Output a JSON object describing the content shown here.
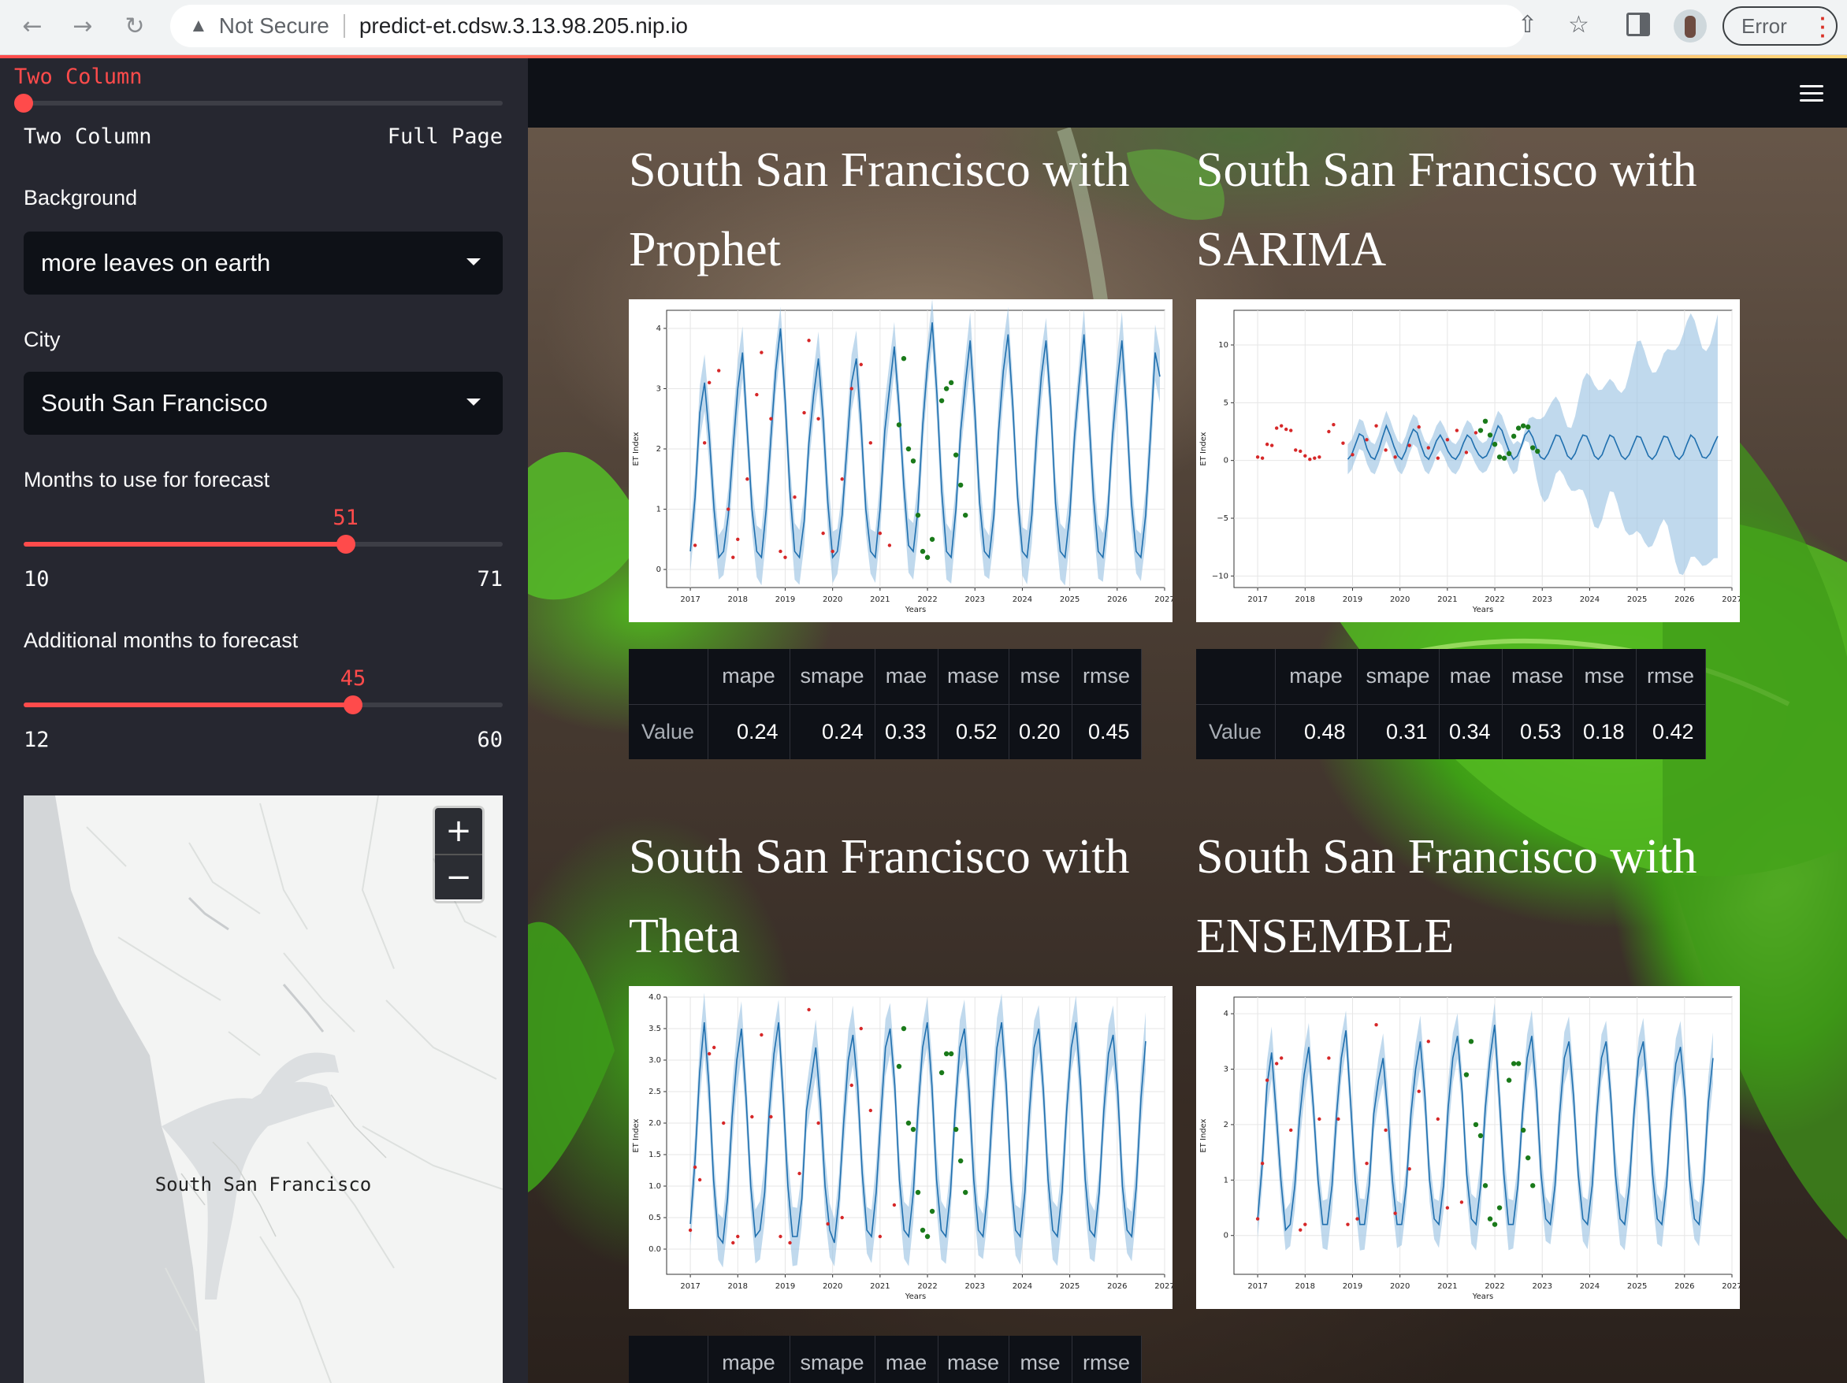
{
  "browser": {
    "security_label": "Not Secure",
    "url": "predict-et.cdsw.3.13.98.205.nip.io",
    "error_label": "Error"
  },
  "sidebar": {
    "layout_selected": "Two Column",
    "layout_slider": {
      "min_label": "Two Column",
      "max_label": "Full Page",
      "position": 0
    },
    "background": {
      "label": "Background",
      "value": "more leaves on earth"
    },
    "city": {
      "label": "City",
      "value": "South San Francisco"
    },
    "months_forecast": {
      "label": "Months to use for forecast",
      "value": "51",
      "min": "10",
      "max": "71"
    },
    "additional_months": {
      "label": "Additional months to forecast",
      "value": "45",
      "min": "12",
      "max": "60"
    },
    "map": {
      "city_label": "South San Francisco",
      "zoom_in": "+",
      "zoom_out": "−"
    }
  },
  "metric_headers": [
    "mape",
    "smape",
    "mae",
    "mase",
    "mse",
    "rmse"
  ],
  "metric_row_label": "Value",
  "panels": [
    {
      "title_line1": "South San Francisco with",
      "title_line2": "Prophet",
      "metrics": [
        "0.24",
        "0.24",
        "0.33",
        "0.52",
        "0.20",
        "0.45"
      ]
    },
    {
      "title_line1": "South San Francisco with",
      "title_line2": "SARIMA",
      "metrics": [
        "0.48",
        "0.31",
        "0.34",
        "0.53",
        "0.18",
        "0.42"
      ]
    },
    {
      "title_line1": "South San Francisco with",
      "title_line2": "Theta"
    },
    {
      "title_line1": "South San Francisco with",
      "title_line2": "ENSEMBLE"
    }
  ],
  "chart_data": [
    {
      "type": "line",
      "xlabel": "Years",
      "ylabel": "ET Index",
      "x_ticks": [
        "2017",
        "2018",
        "2019",
        "2020",
        "2021",
        "2022",
        "2023",
        "2024",
        "2025",
        "2026",
        "2027"
      ],
      "y_ticks": [
        "0",
        "1",
        "2",
        "3",
        "4"
      ],
      "ylim": [
        -0.3,
        4.3
      ],
      "series": [
        {
          "name": "",
          "type": "line",
          "x_range": [
            2017.0,
            2026.9
          ],
          "values": [
            0.3,
            1.2,
            2.6,
            3.1,
            2.2,
            1.0,
            0.2,
            0.3,
            0.9,
            2.0,
            3.0,
            3.6,
            2.3,
            1.0,
            0.3,
            0.2,
            1.0,
            2.2,
            3.3,
            4.0,
            2.8,
            1.3,
            0.3,
            0.2,
            0.8,
            2.1,
            2.9,
            3.5,
            2.5,
            1.1,
            0.2,
            0.3,
            0.9,
            2.0,
            3.1,
            3.5,
            2.4,
            1.0,
            0.3,
            0.2,
            1.0,
            2.3,
            3.0,
            3.7,
            2.7,
            1.4,
            0.4,
            0.3,
            1.0,
            2.4,
            3.4,
            4.1,
            2.9,
            1.3,
            0.3,
            0.2,
            1.0,
            2.3,
            3.1,
            3.8,
            2.6,
            1.1,
            0.3,
            0.2,
            0.9,
            2.3,
            3.3,
            3.9,
            2.7,
            1.2,
            0.3,
            0.2,
            0.9,
            2.2,
            3.2,
            3.8,
            2.7,
            1.1,
            0.3,
            0.2,
            0.9,
            2.2,
            3.1,
            3.9,
            2.6,
            1.2,
            0.3,
            0.2,
            0.9,
            2.2,
            3.1,
            3.8,
            2.6,
            1.1,
            0.3,
            0.2,
            0.9,
            2.2,
            3.6,
            3.2
          ]
        },
        {
          "name": "",
          "type": "points",
          "color": "#d62728",
          "x": [
            2017.1,
            2017.3,
            2017.4,
            2017.6,
            2017.8,
            2017.9,
            2018.0,
            2018.2,
            2018.4,
            2018.5,
            2018.7,
            2018.9,
            2019.0,
            2019.2,
            2019.4,
            2019.5,
            2019.7,
            2019.8,
            2020.0,
            2020.2,
            2020.4,
            2020.6,
            2020.8,
            2021.0,
            2021.2
          ],
          "y": [
            0.4,
            2.1,
            3.1,
            3.3,
            1.0,
            0.2,
            0.5,
            1.5,
            2.9,
            3.6,
            2.5,
            0.3,
            0.2,
            1.2,
            2.6,
            3.8,
            2.5,
            0.6,
            0.3,
            1.5,
            3.0,
            3.4,
            2.1,
            0.6,
            0.4
          ]
        },
        {
          "name": "",
          "type": "points",
          "color": "#1a7a1a",
          "x": [
            2021.4,
            2021.5,
            2021.6,
            2021.7,
            2021.8,
            2021.9,
            2022.0,
            2022.1,
            2022.3,
            2022.4,
            2022.5,
            2022.6,
            2022.7,
            2022.8
          ],
          "y": [
            2.4,
            3.5,
            2.0,
            1.8,
            0.9,
            0.3,
            0.2,
            0.5,
            2.8,
            3.0,
            3.1,
            1.9,
            1.4,
            0.9
          ]
        }
      ]
    },
    {
      "type": "line",
      "xlabel": "Years",
      "ylabel": "ET Index",
      "x_ticks": [
        "2017",
        "2018",
        "2019",
        "2020",
        "2021",
        "2022",
        "2023",
        "2024",
        "2025",
        "2026",
        "2027"
      ],
      "y_ticks": [
        "−10",
        "−5",
        "0",
        "5",
        "10"
      ],
      "ylim": [
        -11,
        13
      ],
      "series": [
        {
          "name": "",
          "type": "line",
          "x_range": [
            2018.9,
            2026.7
          ],
          "values": [
            0.1,
            0.5,
            1.4,
            2.3,
            2.1,
            1.0,
            0.3,
            0.1,
            0.9,
            2.0,
            3.0,
            2.2,
            1.2,
            0.4,
            0.1,
            0.8,
            1.9,
            2.7,
            2.4,
            1.3,
            0.4,
            0.1,
            0.8,
            1.7,
            2.2,
            1.6,
            0.8,
            0.3,
            0.1,
            0.6,
            1.5,
            2.2,
            1.9,
            1.1,
            0.5,
            0.2,
            0.4,
            1.1,
            2.1,
            3.0,
            2.6,
            1.6,
            0.7,
            0.1,
            0.4,
            1.2,
            2.2,
            2.6,
            2.0,
            1.0,
            0.3,
            0.1,
            0.6,
            1.4,
            2.2,
            2.1,
            1.3,
            0.4,
            0.1,
            0.6,
            1.5,
            2.2,
            2.1,
            1.3,
            0.4,
            0.1,
            0.5,
            1.4,
            2.2,
            2.0,
            1.2,
            0.4,
            0.1,
            0.5,
            1.3,
            2.1,
            2.0,
            1.2,
            0.4,
            0.1,
            0.5,
            1.3,
            2.1,
            2.0,
            1.2,
            0.4,
            0.1,
            0.5,
            1.4,
            2.2,
            1.9,
            1.1,
            0.3,
            0.2,
            0.6,
            1.4,
            2.1
          ]
        },
        {
          "name": "",
          "type": "points",
          "color": "#d62728",
          "x": [
            2017.0,
            2017.1,
            2017.2,
            2017.3,
            2017.4,
            2017.5,
            2017.6,
            2017.7,
            2017.8,
            2017.9,
            2018.0,
            2018.1,
            2018.2,
            2018.3,
            2018.5,
            2018.6,
            2018.8,
            2019.0,
            2019.3,
            2019.5,
            2019.7,
            2019.9,
            2020.2,
            2020.4,
            2020.6,
            2020.8,
            2021.0,
            2021.2,
            2021.4,
            2021.6
          ],
          "y": [
            0.3,
            0.2,
            1.4,
            1.3,
            2.8,
            3.0,
            2.7,
            2.6,
            0.9,
            0.8,
            0.4,
            0.1,
            0.2,
            0.3,
            2.5,
            3.1,
            1.5,
            0.5,
            1.8,
            3.0,
            0.9,
            0.3,
            1.3,
            2.9,
            1.1,
            0.2,
            1.8,
            2.6,
            0.7,
            2.4
          ]
        },
        {
          "name": "",
          "type": "points",
          "color": "#1a7a1a",
          "x": [
            2021.7,
            2021.8,
            2021.9,
            2022.0,
            2022.1,
            2022.2,
            2022.3,
            2022.4,
            2022.5,
            2022.6,
            2022.7,
            2022.8,
            2022.9
          ],
          "y": [
            2.6,
            3.4,
            2.2,
            1.4,
            0.3,
            0.2,
            0.6,
            2.1,
            2.8,
            3.0,
            2.9,
            1.1,
            0.8
          ]
        }
      ]
    },
    {
      "type": "line",
      "xlabel": "Years",
      "ylabel": "ET Index",
      "x_ticks": [
        "2017",
        "2018",
        "2019",
        "2020",
        "2021",
        "2022",
        "2023",
        "2024",
        "2025",
        "2026",
        "2027"
      ],
      "y_ticks": [
        "0.0",
        "0.5",
        "1.0",
        "1.5",
        "2.0",
        "2.5",
        "3.0",
        "3.5",
        "4.0"
      ],
      "ylim": [
        -0.4,
        4.0
      ],
      "series": [
        {
          "name": "",
          "type": "line",
          "x_range": [
            2017.0,
            2026.6
          ],
          "values": [
            0.4,
            1.4,
            2.8,
            3.6,
            2.6,
            1.1,
            0.2,
            0.1,
            0.8,
            2.1,
            3.0,
            3.5,
            2.4,
            1.0,
            0.2,
            0.3,
            0.9,
            2.2,
            3.1,
            3.6,
            2.4,
            1.0,
            0.2,
            0.2,
            0.8,
            2.2,
            2.7,
            3.2,
            2.3,
            1.0,
            0.3,
            0.1,
            0.8,
            2.0,
            3.0,
            3.4,
            2.6,
            1.2,
            0.3,
            0.2,
            0.9,
            2.1,
            3.2,
            3.5,
            2.6,
            1.1,
            0.3,
            0.2,
            0.9,
            2.2,
            3.2,
            3.6,
            2.6,
            1.1,
            0.3,
            0.2,
            0.9,
            2.2,
            3.2,
            3.5,
            2.5,
            1.1,
            0.3,
            0.2,
            0.9,
            2.2,
            3.2,
            3.6,
            2.6,
            1.1,
            0.3,
            0.2,
            0.9,
            2.2,
            3.2,
            3.5,
            2.5,
            1.1,
            0.3,
            0.2,
            0.9,
            2.2,
            3.2,
            3.6,
            2.6,
            1.1,
            0.3,
            0.2,
            0.9,
            2.2,
            3.1,
            3.4,
            2.5,
            1.0,
            0.3,
            0.2,
            1.0,
            2.4,
            3.3
          ]
        },
        {
          "name": "",
          "type": "points",
          "color": "#d62728",
          "x": [
            2017.0,
            2017.1,
            2017.2,
            2017.4,
            2017.5,
            2017.7,
            2017.9,
            2018.0,
            2018.3,
            2018.5,
            2018.7,
            2018.9,
            2019.1,
            2019.3,
            2019.5,
            2019.7,
            2019.9,
            2020.2,
            2020.4,
            2020.6,
            2020.8,
            2021.0,
            2021.3
          ],
          "y": [
            0.3,
            1.3,
            1.1,
            3.1,
            3.2,
            2.0,
            0.1,
            0.2,
            2.1,
            3.4,
            2.1,
            0.2,
            0.1,
            1.2,
            3.8,
            2.0,
            0.4,
            0.5,
            2.6,
            3.5,
            2.2,
            0.2,
            0.7
          ]
        },
        {
          "name": "",
          "type": "points",
          "color": "#1a7a1a",
          "x": [
            2021.4,
            2021.5,
            2021.6,
            2021.7,
            2021.8,
            2021.9,
            2022.0,
            2022.1,
            2022.3,
            2022.4,
            2022.5,
            2022.6,
            2022.7,
            2022.8
          ],
          "y": [
            2.9,
            3.5,
            2.0,
            1.9,
            0.9,
            0.3,
            0.2,
            0.6,
            2.8,
            3.1,
            3.1,
            1.9,
            1.4,
            0.9
          ]
        }
      ]
    },
    {
      "type": "line",
      "xlabel": "Years",
      "ylabel": "ET Index",
      "x_ticks": [
        "2017",
        "2018",
        "2019",
        "2020",
        "2021",
        "2022",
        "2023",
        "2024",
        "2025",
        "2026",
        "2027"
      ],
      "y_ticks": [
        "0",
        "1",
        "2",
        "3",
        "4"
      ],
      "ylim": [
        -0.7,
        4.3
      ],
      "series": [
        {
          "name": "",
          "type": "line",
          "x_range": [
            2017.0,
            2026.6
          ],
          "values": [
            0.3,
            1.3,
            2.7,
            3.3,
            2.2,
            1.0,
            0.1,
            0.2,
            0.9,
            2.1,
            2.9,
            3.4,
            2.3,
            1.0,
            0.2,
            0.2,
            0.9,
            2.2,
            3.2,
            3.7,
            2.4,
            1.0,
            0.2,
            0.2,
            0.9,
            2.2,
            2.8,
            3.2,
            2.2,
            1.0,
            0.2,
            0.2,
            0.9,
            2.2,
            3.0,
            3.5,
            2.5,
            1.0,
            0.3,
            0.2,
            0.9,
            2.3,
            3.2,
            3.6,
            2.6,
            1.1,
            0.3,
            0.2,
            0.9,
            2.3,
            3.2,
            3.8,
            2.5,
            1.1,
            0.2,
            0.2,
            0.9,
            2.2,
            3.2,
            3.6,
            2.6,
            1.1,
            0.3,
            0.2,
            0.9,
            2.2,
            3.2,
            3.5,
            2.5,
            1.1,
            0.3,
            0.2,
            0.9,
            2.2,
            3.2,
            3.5,
            2.5,
            1.1,
            0.3,
            0.2,
            0.9,
            2.2,
            3.2,
            3.5,
            2.5,
            1.1,
            0.3,
            0.2,
            0.9,
            2.2,
            3.1,
            3.4,
            2.5,
            1.0,
            0.3,
            0.2,
            1.0,
            2.4,
            3.2
          ]
        },
        {
          "name": "",
          "type": "points",
          "color": "#d62728",
          "x": [
            2017.0,
            2017.1,
            2017.2,
            2017.4,
            2017.5,
            2017.7,
            2017.9,
            2018.0,
            2018.3,
            2018.5,
            2018.7,
            2018.9,
            2019.1,
            2019.3,
            2019.5,
            2019.7,
            2019.9,
            2020.2,
            2020.4,
            2020.6,
            2020.8,
            2021.0,
            2021.3
          ],
          "y": [
            0.3,
            1.3,
            2.8,
            3.1,
            3.2,
            1.9,
            0.1,
            0.2,
            2.1,
            3.2,
            2.1,
            0.2,
            0.3,
            1.3,
            3.8,
            1.9,
            0.4,
            1.2,
            2.6,
            3.5,
            2.1,
            0.5,
            0.6
          ]
        },
        {
          "name": "",
          "type": "points",
          "color": "#1a7a1a",
          "x": [
            2021.4,
            2021.5,
            2021.6,
            2021.7,
            2021.8,
            2021.9,
            2022.0,
            2022.1,
            2022.3,
            2022.4,
            2022.5,
            2022.6,
            2022.7,
            2022.8
          ],
          "y": [
            2.9,
            3.5,
            2.0,
            1.8,
            0.9,
            0.3,
            0.2,
            0.5,
            2.8,
            3.1,
            3.1,
            1.9,
            1.4,
            0.9
          ]
        }
      ]
    }
  ]
}
